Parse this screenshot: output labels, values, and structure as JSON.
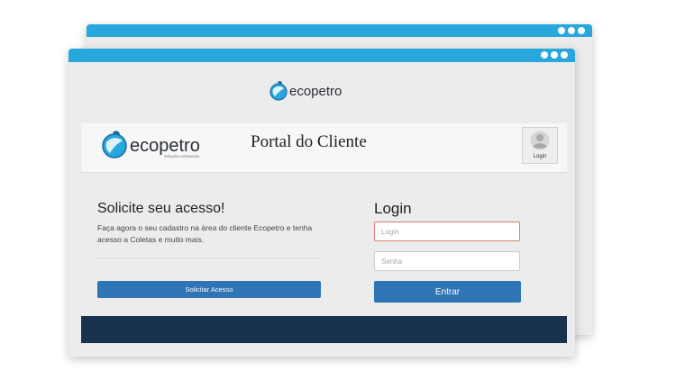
{
  "brand": {
    "name": "ecopetro",
    "tagline": "Soluções Ambientais",
    "primary_color": "#27a7dc",
    "button_color": "#2f74b5",
    "footer_color": "#19324d",
    "logo_icon": "ecopetro-globe-logo-icon"
  },
  "window": {
    "controls": [
      "dot",
      "dot",
      "dot"
    ]
  },
  "header": {
    "title": "Portal do Cliente",
    "login_label": "Login",
    "login_icon": "user-avatar-icon"
  },
  "signup": {
    "heading": "Solicite seu acesso!",
    "description": "Faça agora o seu cadastro na área do cliente Ecopetro e tenha acesso a Coletas e muito mais.",
    "button_label": "Solicitar Acesso"
  },
  "login": {
    "heading": "Login",
    "username_placeholder": "Login",
    "password_placeholder": "Senha",
    "submit_label": "Entrar"
  }
}
